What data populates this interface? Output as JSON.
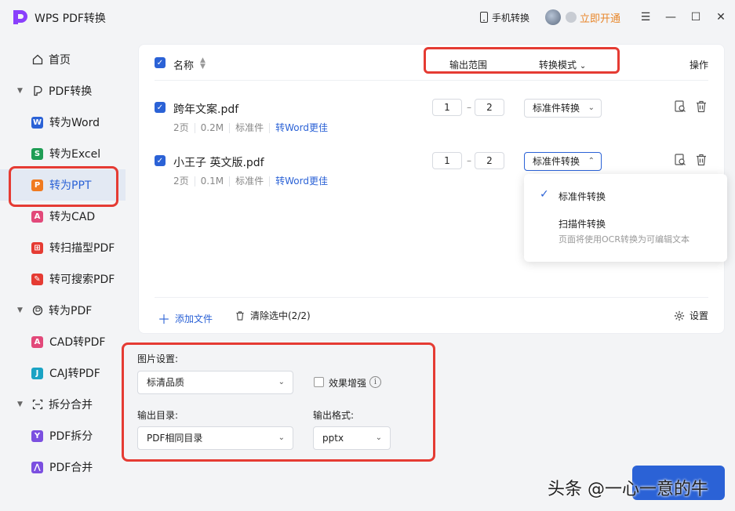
{
  "app": {
    "title": "WPS PDF转换",
    "brand_color": "#8a3ffc",
    "accent": "#2b62d6"
  },
  "titlebar": {
    "phone_convert": "手机转换",
    "vip": "立即开通",
    "menu": "☰",
    "minimize": "—",
    "maximize": "☐",
    "close": "✕"
  },
  "sidebar": {
    "home": "首页",
    "group_from_pdf": "PDF转换",
    "to_word": "转为Word",
    "to_excel": "转为Excel",
    "to_ppt": "转为PPT",
    "to_cad": "转为CAD",
    "to_scan_pdf": "转扫描型PDF",
    "to_search_pdf": "转可搜索PDF",
    "group_to_pdf": "转为PDF",
    "cad_to_pdf": "CAD转PDF",
    "caj_to_pdf": "CAJ转PDF",
    "group_split_merge": "拆分合并",
    "pdf_split": "PDF拆分",
    "pdf_merge": "PDF合并"
  },
  "table": {
    "col_name": "名称",
    "col_range": "输出范围",
    "col_mode": "转换模式",
    "col_op": "操作",
    "rows": [
      {
        "name": "跨年文案.pdf",
        "pages": "2页",
        "size": "0.2M",
        "type": "标准件",
        "link": "转Word更佳",
        "from": "1",
        "to": "2",
        "mode": "标准件转换"
      },
      {
        "name": "小王子 英文版.pdf",
        "pages": "2页",
        "size": "0.1M",
        "type": "标准件",
        "link": "转Word更佳",
        "from": "1",
        "to": "2",
        "mode": "标准件转换"
      }
    ]
  },
  "dropdown": {
    "option1": "标准件转换",
    "option2": "扫描件转换",
    "option2_desc": "页面将使用OCR转换为可编辑文本"
  },
  "footer": {
    "add_file": "添加文件",
    "clear_selected": "清除选中(2/2)",
    "settings": "设置"
  },
  "options": {
    "image_label": "图片设置:",
    "image_value": "标清品质",
    "enhance_label": "效果增强",
    "out_dir_label": "输出目录:",
    "out_dir_value": "PDF相同目录",
    "out_fmt_label": "输出格式:",
    "out_fmt_value": "pptx"
  },
  "watermark": "头条 @一心一意的牛"
}
